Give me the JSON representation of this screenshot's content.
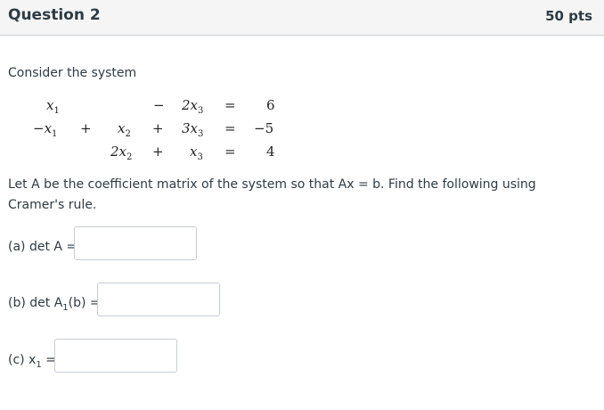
{
  "header": {
    "title": "Question 2",
    "points": "50 pts"
  },
  "prompt": "Consider the system",
  "system": {
    "row1": {
      "x1": "x",
      "x1_sub": "1",
      "op2": "−",
      "c3": "2x",
      "c3_sub": "3",
      "eq": "=",
      "rhs": "6"
    },
    "row2": {
      "x1": "−x",
      "x1_sub": "1",
      "op1": "+",
      "x2": "x",
      "x2_sub": "2",
      "op2": "+",
      "c3": "3x",
      "c3_sub": "3",
      "eq": "=",
      "rhs": "−5"
    },
    "row3": {
      "x2": "2x",
      "x2_sub": "2",
      "op2": "+",
      "c3": "x",
      "c3_sub": "3",
      "eq": "=",
      "rhs": "4"
    }
  },
  "instructions": "Let A be the coefficient matrix of the system so that Ax = b.  Find the following using Cramer's rule.",
  "parts": {
    "a": {
      "label": "(a)  det A =",
      "value": ""
    },
    "b": {
      "label_pre": "(b)  det A",
      "label_sub": "1",
      "label_post": "(b) =",
      "value": ""
    },
    "c": {
      "label_pre": "(c)  x",
      "label_sub": "1",
      "label_post": " =",
      "value": ""
    }
  }
}
